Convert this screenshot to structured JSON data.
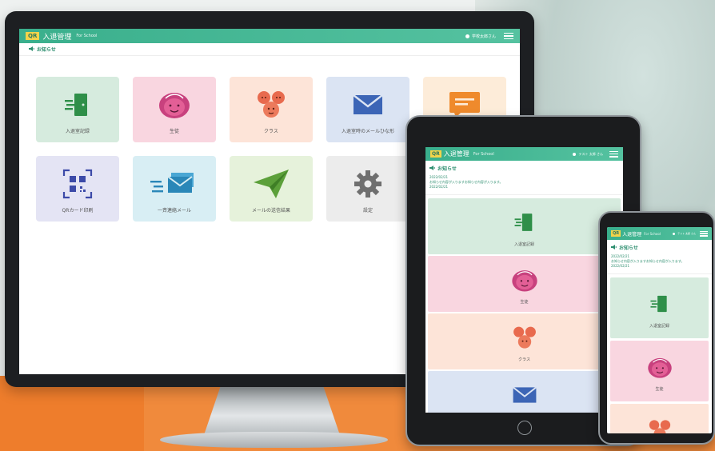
{
  "app": {
    "badge": "QR",
    "title": "入退管理",
    "subtitle": "For School",
    "user_label_desktop": "学校太郎さん",
    "user_label_tablet": "テスト 太郎 さん",
    "user_label_phone": "テスト 太郎 さん"
  },
  "notice": {
    "heading": "お知らせ",
    "date": "2022/02/21",
    "text": "お知らせ内容が入りますお知らせ内容が入ります。",
    "date2": "2022/02/21"
  },
  "menu": [
    {
      "label": "入退室記録",
      "icon": "door-exit-icon",
      "color": "#d6ebde"
    },
    {
      "label": "生徒",
      "icon": "student-face-icon",
      "color": "#f9d6e0"
    },
    {
      "label": "クラス",
      "icon": "class-group-icon",
      "color": "#fde4d8"
    },
    {
      "label": "入退室時のメールひな形",
      "icon": "mail-template-icon",
      "color": "#dbe4f3"
    },
    {
      "label": "",
      "icon": "message-board-icon",
      "color": "#fdecd9"
    },
    {
      "label": "QRカード印刷",
      "icon": "qr-card-icon",
      "color": "#e4e4f4"
    },
    {
      "label": "一斉連絡メール",
      "icon": "bulk-mail-icon",
      "color": "#d8eef4"
    },
    {
      "label": "メールの送信結果",
      "icon": "paper-plane-icon",
      "color": "#e6f2db"
    },
    {
      "label": "設定",
      "icon": "gear-icon",
      "color": "#ececec"
    }
  ]
}
